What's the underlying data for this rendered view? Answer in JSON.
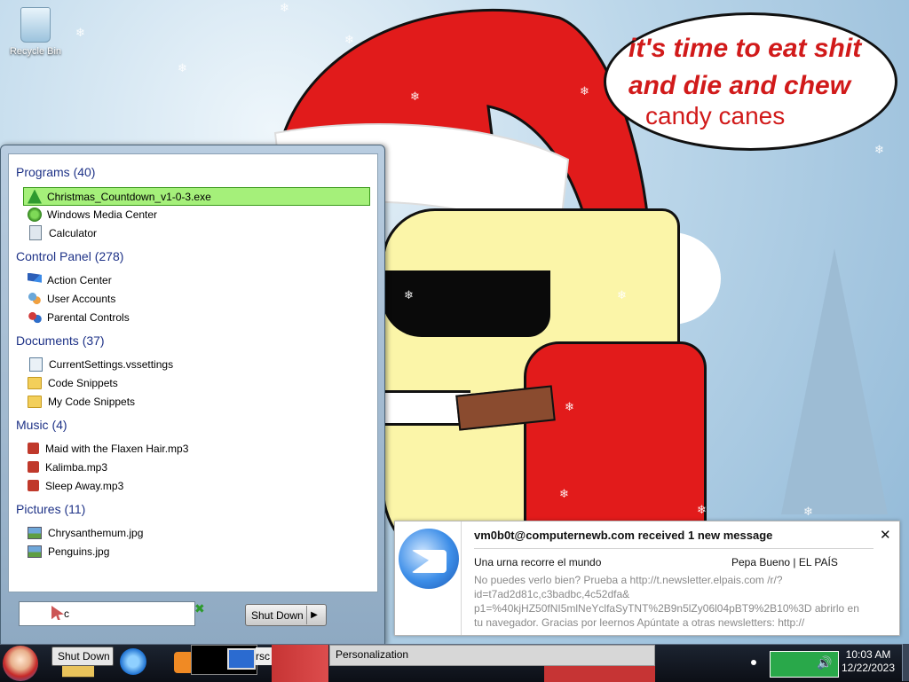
{
  "desktop": {
    "icons": [
      {
        "label": "Recycle Bin",
        "icon": "recycle-bin-icon"
      }
    ],
    "wallpaper": {
      "speech_line1": "it's time to eat shit and die and chew",
      "speech_line2": "candy canes"
    }
  },
  "start_menu": {
    "groups": [
      {
        "title": "Programs (40)",
        "items": [
          {
            "label": "Christmas_Countdown_v1-0-3.exe",
            "icon": "exe-icon",
            "selected": true
          },
          {
            "label": "Windows Media Center",
            "icon": "media-center-icon"
          },
          {
            "label": "Calculator",
            "icon": "calculator-icon"
          }
        ]
      },
      {
        "title": "Control Panel (278)",
        "items": [
          {
            "label": "Action Center",
            "icon": "flag-icon"
          },
          {
            "label": "User Accounts",
            "icon": "users-icon"
          },
          {
            "label": "Parental Controls",
            "icon": "parental-controls-icon"
          }
        ]
      },
      {
        "title": "Documents (37)",
        "items": [
          {
            "label": "CurrentSettings.vssettings",
            "icon": "settings-file-icon"
          },
          {
            "label": "Code Snippets",
            "icon": "folder-icon"
          },
          {
            "label": "My Code Snippets",
            "icon": "folder-icon"
          }
        ]
      },
      {
        "title": "Music (4)",
        "items": [
          {
            "label": "Maid with the Flaxen Hair.mp3",
            "icon": "audio-file-icon"
          },
          {
            "label": "Kalimba.mp3",
            "icon": "audio-file-icon"
          },
          {
            "label": "Sleep Away.mp3",
            "icon": "audio-file-icon"
          }
        ]
      },
      {
        "title": "Pictures (11)",
        "items": [
          {
            "label": "Chrysanthemum.jpg",
            "icon": "image-file-icon"
          },
          {
            "label": "Penguins.jpg",
            "icon": "image-file-icon"
          }
        ]
      }
    ],
    "search_value": "c",
    "shutdown_label": "Shut Down"
  },
  "notification": {
    "title": "vm0b0t@computernewb.com received 1 new message",
    "subject": "Una urna recorre el mundo",
    "sender": "Pepa Bueno | EL PAÍS",
    "body": "No puedes verlo bien? Prueba a http://t.newsletter.elpais.com /r/?id=t7ad2d81c,c3badbc,4c52dfa& p1=%40kjHZ50fNI5mlNeYclfaSyTNT%2B9n5lZy06l04pBT9%2B10%3D abrirlo en tu navegador. Gracias por leernos Apúntate a otras newsletters: http://",
    "close_icon": "close-icon"
  },
  "taskbar": {
    "shutdown_ghost": "Shut Down",
    "rsc_label": "rsc",
    "active_window": "Personalization",
    "clock_time": "10:03 AM",
    "clock_date": "12/22/2023"
  }
}
